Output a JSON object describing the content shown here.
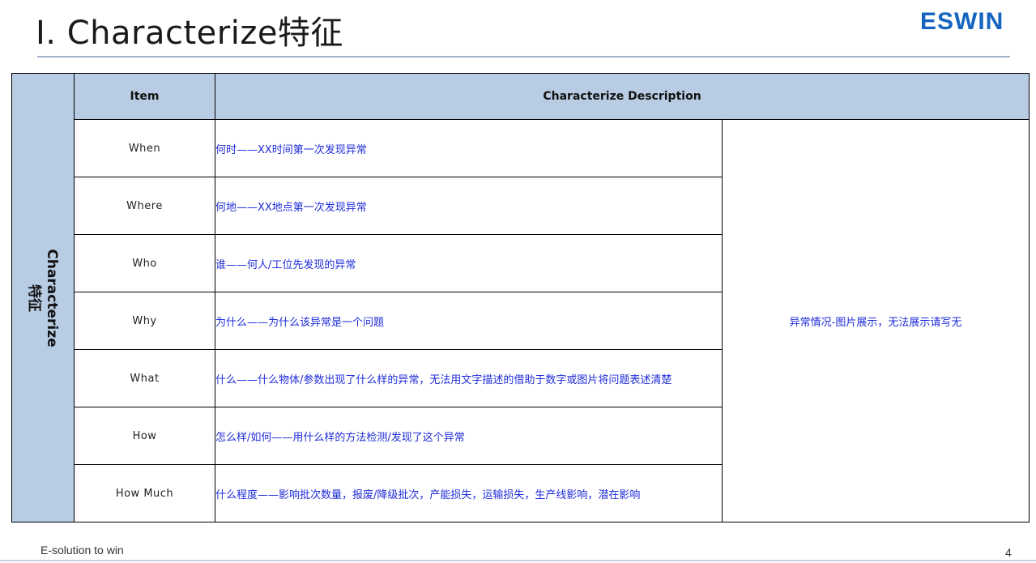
{
  "slide": {
    "title": "I. Characterize特征",
    "logo_text": "ESWIN",
    "footer_left": "E-solution to win",
    "page_number": "4"
  },
  "table": {
    "side_label_en": "Characterize",
    "side_label_cn": "特征",
    "headers": {
      "item": "Item",
      "description": "Characterize Description"
    },
    "rows": [
      {
        "item": "When",
        "description": "何时——XX时间第一次发现异常"
      },
      {
        "item": "Where",
        "description": "何地——XX地点第一次发现异常"
      },
      {
        "item": "Who",
        "description": "谁——何人/工位先发现的异常"
      },
      {
        "item": "Why",
        "description": "为什么——为什么该异常是一个问题"
      },
      {
        "item": "What",
        "description": "什么——什么物体/参数出现了什么样的异常，无法用文字描述的借助于数字或图片将问题表述清楚"
      },
      {
        "item": "How",
        "description": "怎么样/如何——用什么样的方法检测/发现了这个异常"
      },
      {
        "item": "How Much",
        "description": "什么程度——影响批次数量，报废/降级批次，产能损失，运输损失，生产线影响，潜在影响"
      }
    ],
    "image_note": "异常情况-图片展示，无法展示请写无"
  }
}
